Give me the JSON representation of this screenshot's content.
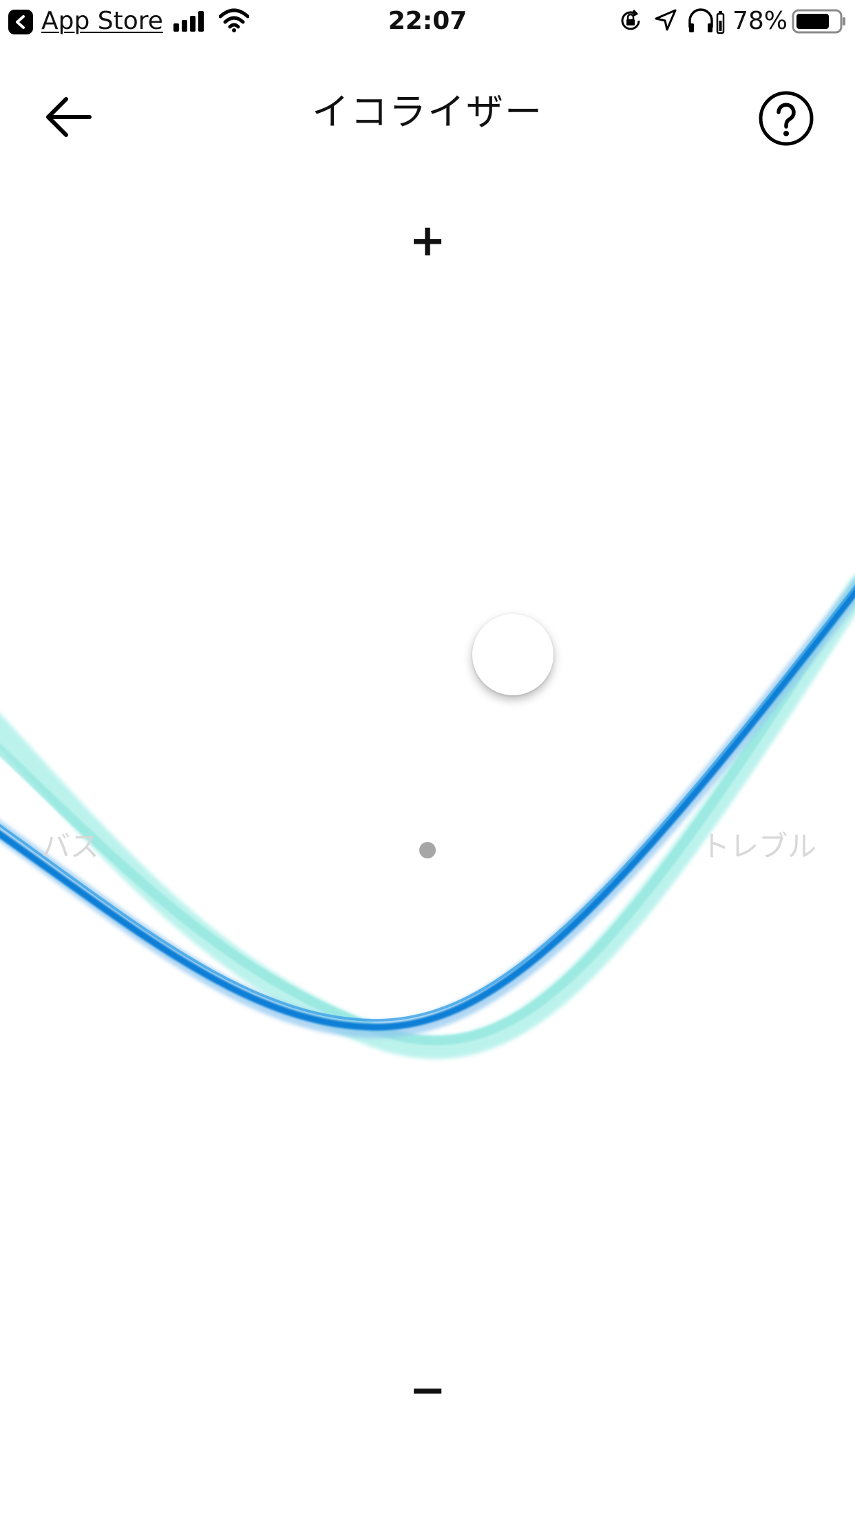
{
  "status_bar": {
    "back_app": "App Store",
    "time": "22:07",
    "battery_percent": "78%",
    "battery_level": 0.78,
    "icons": [
      "signal-icon",
      "wifi-icon",
      "rotation-lock-icon",
      "location-icon",
      "headphones-icon",
      "battery-icon"
    ]
  },
  "nav": {
    "title": "イコライザー",
    "back_icon": "arrow-left-icon",
    "help_icon": "question-circle-icon"
  },
  "equalizer": {
    "plus": "+",
    "minus": "−",
    "bass": "バス",
    "treble": "トレブル",
    "colors": {
      "curve_primary": "#0a7fd6",
      "curve_secondary": "#7ee8df",
      "label": "#d8d8d8",
      "center_dot": "#a6a6a6"
    }
  }
}
